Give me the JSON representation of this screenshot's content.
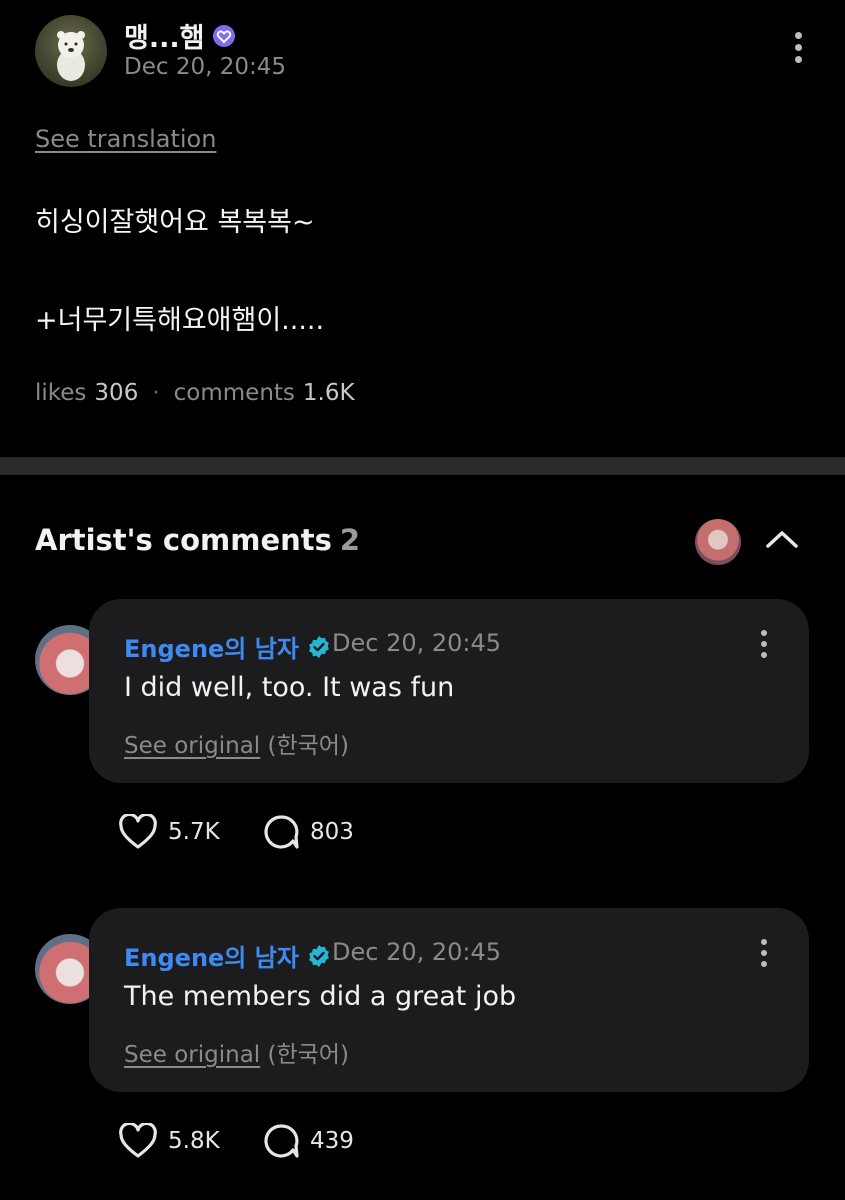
{
  "post": {
    "author": "맹...햄",
    "time": "Dec 20, 20:45",
    "see_translation": "See translation",
    "line1": "히싱이잘햇어요 복복복~",
    "line2": "+너무기특해요애햄이.....",
    "likes_label": "likes",
    "likes_count": "306",
    "comments_label": "comments",
    "comments_count": "1.6K"
  },
  "artist_comments": {
    "title": "Artist's comments",
    "count": "2",
    "items": [
      {
        "author": "Engene의 남자",
        "time": "Dec 20, 20:45",
        "text": "I did well, too. It was fun",
        "see_original": "See original",
        "language": "(한국어)",
        "likes": "5.7K",
        "replies": "803"
      },
      {
        "author": "Engene의 남자",
        "time": "Dec 20, 20:45",
        "text": "The members did a great job",
        "see_original": "See original",
        "language": "(한국어)",
        "likes": "5.8K",
        "replies": "439"
      }
    ]
  },
  "icons": {
    "more": "more-vertical-icon",
    "verified_fan": "verified-badge-icon",
    "verified_artist": "verified-badge-icon",
    "collapse": "chevron-up-icon",
    "like": "heart-icon",
    "reply": "comment-bubble-icon"
  },
  "colors": {
    "background": "#000000",
    "accent_blue": "#3d8bf2",
    "artist_badge": "#27b5d6",
    "fan_badge": "#8b5cf6",
    "bubble": "#1c1c1e"
  }
}
